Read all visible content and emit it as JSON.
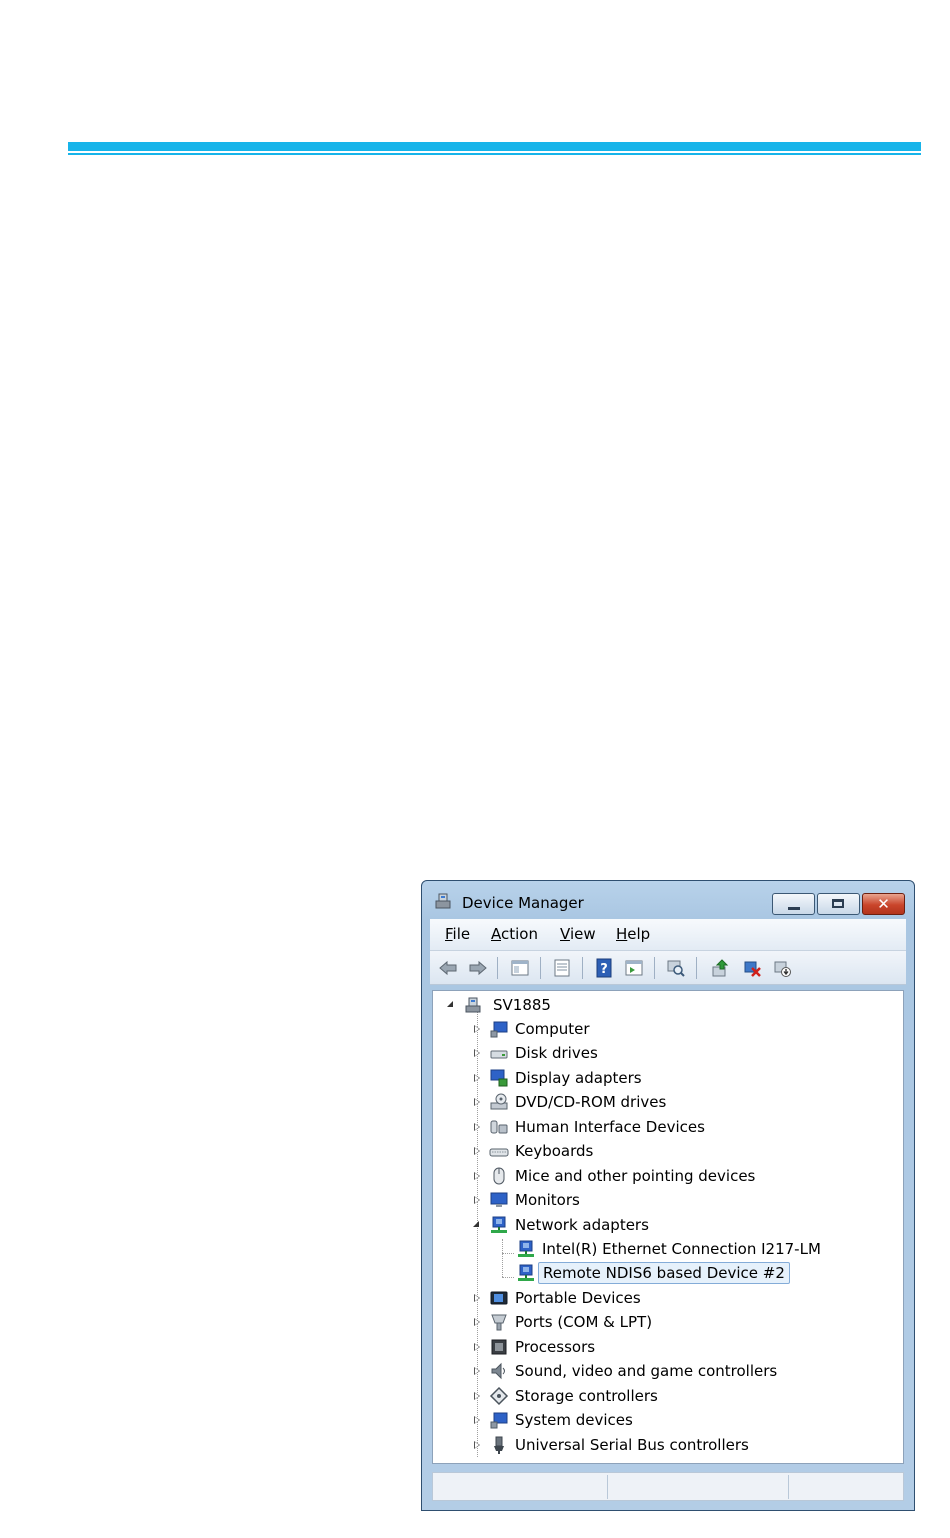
{
  "window": {
    "title": "Device Manager",
    "close_glyph": "✕"
  },
  "menu": [
    {
      "label": "File",
      "mnemonic": "F",
      "rest": "ile"
    },
    {
      "label": "Action",
      "mnemonic": "A",
      "rest": "ction"
    },
    {
      "label": "View",
      "mnemonic": "V",
      "rest": "iew"
    },
    {
      "label": "Help",
      "mnemonic": "H",
      "rest": "elp"
    }
  ],
  "toolbar": [
    "back-arrow-icon",
    "forward-arrow-icon",
    "show-hide-console-tree-icon",
    "properties-icon",
    "help-icon",
    "action-pane-icon",
    "scan-hardware-icon",
    "update-driver-icon",
    "disable-device-icon",
    "uninstall-device-icon"
  ],
  "tree": {
    "root": "SV1885",
    "categories": [
      {
        "label": "Computer",
        "icon": "computer-icon"
      },
      {
        "label": "Disk drives",
        "icon": "disk-drive-icon"
      },
      {
        "label": "Display adapters",
        "icon": "display-adapter-icon"
      },
      {
        "label": "DVD/CD-ROM drives",
        "icon": "dvd-drive-icon"
      },
      {
        "label": "Human Interface Devices",
        "icon": "hid-icon"
      },
      {
        "label": "Keyboards",
        "icon": "keyboard-icon"
      },
      {
        "label": "Mice and other pointing devices",
        "icon": "mouse-icon"
      },
      {
        "label": "Monitors",
        "icon": "monitor-icon"
      },
      {
        "label": "Network adapters",
        "icon": "network-adapter-icon",
        "expanded": true,
        "children": [
          {
            "label": "Intel(R) Ethernet Connection I217-LM"
          },
          {
            "label": "Remote NDIS6 based Device #2",
            "selected": true
          }
        ]
      },
      {
        "label": "Portable Devices",
        "icon": "portable-device-icon"
      },
      {
        "label": "Ports (COM & LPT)",
        "icon": "port-icon"
      },
      {
        "label": "Processors",
        "icon": "processor-icon"
      },
      {
        "label": "Sound, video and game controllers",
        "icon": "speaker-icon"
      },
      {
        "label": "Storage controllers",
        "icon": "storage-controller-icon"
      },
      {
        "label": "System devices",
        "icon": "system-device-icon"
      },
      {
        "label": "Universal Serial Bus controllers",
        "icon": "usb-icon"
      }
    ]
  }
}
